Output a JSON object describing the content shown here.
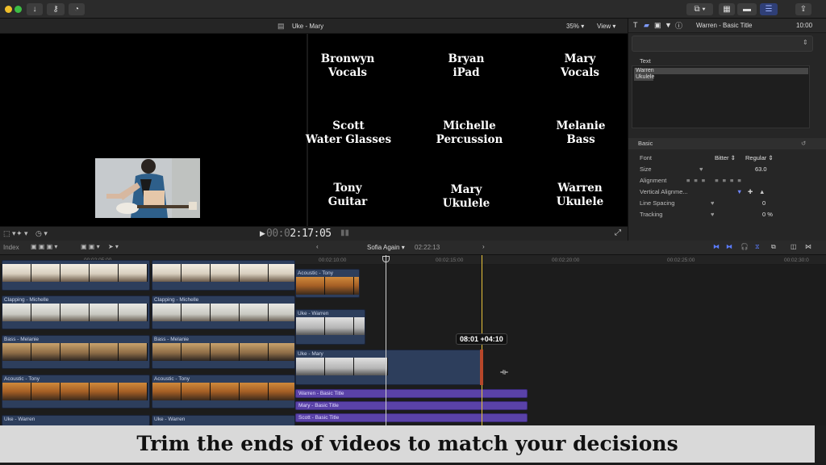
{
  "colors": {
    "accent": "#4a6bd8",
    "clip": "#2d3e5c",
    "title_clip": "#5a42a8",
    "skimmer": "#e8c33a"
  },
  "toolbar": {
    "buttons": [
      "download-icon",
      "key-icon",
      "check-icon"
    ],
    "right_buttons": [
      "layout-icon",
      "browser-icon",
      "timeline-icon",
      "inspector-icon",
      "share-icon"
    ]
  },
  "viewer": {
    "project_name": "Uke - Mary",
    "zoom": "35%",
    "view_menu": "View",
    "names": [
      {
        "name": "Bronwyn",
        "role": "Vocals"
      },
      {
        "name": "Bryan",
        "role": "iPad"
      },
      {
        "name": "Mary",
        "role": "Vocals"
      },
      {
        "name": "Scott",
        "role": "Water Glasses"
      },
      {
        "name": "Michelle",
        "role": "Percussion"
      },
      {
        "name": "Melanie",
        "role": "Bass"
      },
      {
        "name": "Tony",
        "role": "Guitar"
      },
      {
        "name": "Mary",
        "role": "Ukulele"
      },
      {
        "name": "Warren",
        "role": "Ukulele"
      }
    ],
    "timecode_dim": "00:0",
    "timecode": "2:17:05"
  },
  "inspector": {
    "title": "Warren - Basic Title",
    "duration": "10:00",
    "text_section": "Text",
    "text_lines": [
      "Warren",
      "Ukulele"
    ],
    "basic_section": "Basic",
    "rows": [
      {
        "label": "Font",
        "value": "Bitter",
        "value2": "Regular"
      },
      {
        "label": "Size",
        "value": "63.0"
      },
      {
        "label": "Alignment",
        "value": ""
      },
      {
        "label": "Vertical Alignme...",
        "value": ""
      },
      {
        "label": "Line Spacing",
        "value": "0"
      },
      {
        "label": "Tracking",
        "value": "0 %"
      }
    ]
  },
  "timeline": {
    "index_label": "Index",
    "project": "Sofia Again",
    "duration": "02:22:13",
    "ruler_ticks": [
      "00:02:05:00",
      "00:02:10:00",
      "00:02:15:00",
      "00:02:20:00",
      "00:02:25:00",
      "00:02:30:0"
    ],
    "clips": {
      "acoustic_tony_top": "Acoustic - Tony",
      "clapping_michelle_1": "Clapping - Michelle",
      "clapping_michelle_2": "Clapping - Michelle",
      "uke_warren": "Uke - Warren",
      "bass_melanie_1": "Bass - Melanie",
      "bass_melanie_2": "Bass - Melanie",
      "uke_mary": "Uke - Mary",
      "acoustic_tony_1": "Acoustic - Tony",
      "acoustic_tony_2": "Acoustic - Tony",
      "uke_warren_bottom_1": "Uke - Warren",
      "uke_warren_bottom_2": "Uke - Warren"
    },
    "titles": [
      "Warren - Basic Title",
      "Mary - Basic Title",
      "Scott - Basic Title"
    ],
    "trim_readout": "08:01  +04:10"
  },
  "caption": "Trim the ends of videos to match your decisions"
}
